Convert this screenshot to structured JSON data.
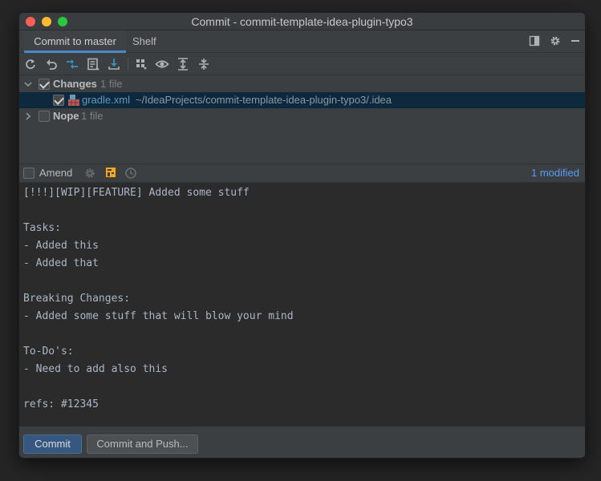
{
  "window": {
    "title": "Commit - commit-template-idea-plugin-typo3"
  },
  "tabs": [
    {
      "label": "Commit to master",
      "active": true
    },
    {
      "label": "Shelf",
      "active": false
    }
  ],
  "tabbar_icons": [
    "layout-icon",
    "gear-icon",
    "minimize-icon"
  ],
  "toolbar_icons": [
    "refresh-icon",
    "rollback-icon",
    "diff-icon",
    "commit-message-icon",
    "update-icon",
    "group-by-icon",
    "eye-icon",
    "expand-all-icon",
    "collapse-all-icon"
  ],
  "changes_tree": {
    "changes": {
      "label": "Changes",
      "count": "1 file",
      "checked": true,
      "expanded": true
    },
    "file": {
      "name": "gradle.xml",
      "path": "~/IdeaProjects/commit-template-idea-plugin-typo3/.idea",
      "checked": true,
      "selected": true
    },
    "nope": {
      "label": "Nope",
      "count": "1 file",
      "checked": false,
      "expanded": false
    }
  },
  "amend": {
    "label": "Amend",
    "checked": false,
    "modified_text": "1 modified"
  },
  "commit_message": {
    "lines": [
      "[!!!][WIP][FEATURE] Added some stuff",
      "",
      "Tasks:",
      "- Added this",
      "- Added that",
      "",
      "Breaking Changes:",
      "- Added some stuff that will blow your mind",
      "",
      "To-Do's:",
      "- Need to add also this",
      "",
      "refs: #12345"
    ]
  },
  "buttons": {
    "commit": "Commit",
    "commit_and_push": "Commit and Push..."
  },
  "colors": {
    "accent": "#4a88c7",
    "primary_button": "#365880",
    "selection": "#0d293e",
    "link": "#589df6"
  }
}
